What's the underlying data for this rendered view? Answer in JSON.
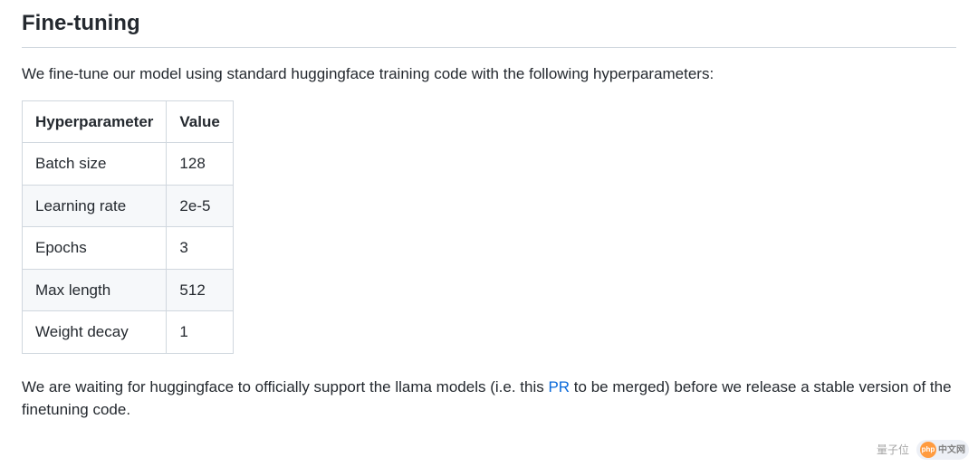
{
  "heading": "Fine-tuning",
  "intro": "We fine-tune our model using standard huggingface training code with the following hyperparameters:",
  "table": {
    "headers": [
      "Hyperparameter",
      "Value"
    ],
    "rows": [
      [
        "Batch size",
        "128"
      ],
      [
        "Learning rate",
        "2e-5"
      ],
      [
        "Epochs",
        "3"
      ],
      [
        "Max length",
        "512"
      ],
      [
        "Weight decay",
        "1"
      ]
    ]
  },
  "outro": {
    "part1": "We are waiting for huggingface to officially support the llama models (i.e. this ",
    "link": "PR",
    "part2": " to be merged) before we release a stable version of the finetuning code."
  },
  "watermarks": {
    "left": "量子位",
    "php_orb": "php",
    "php_text": "中文网"
  }
}
